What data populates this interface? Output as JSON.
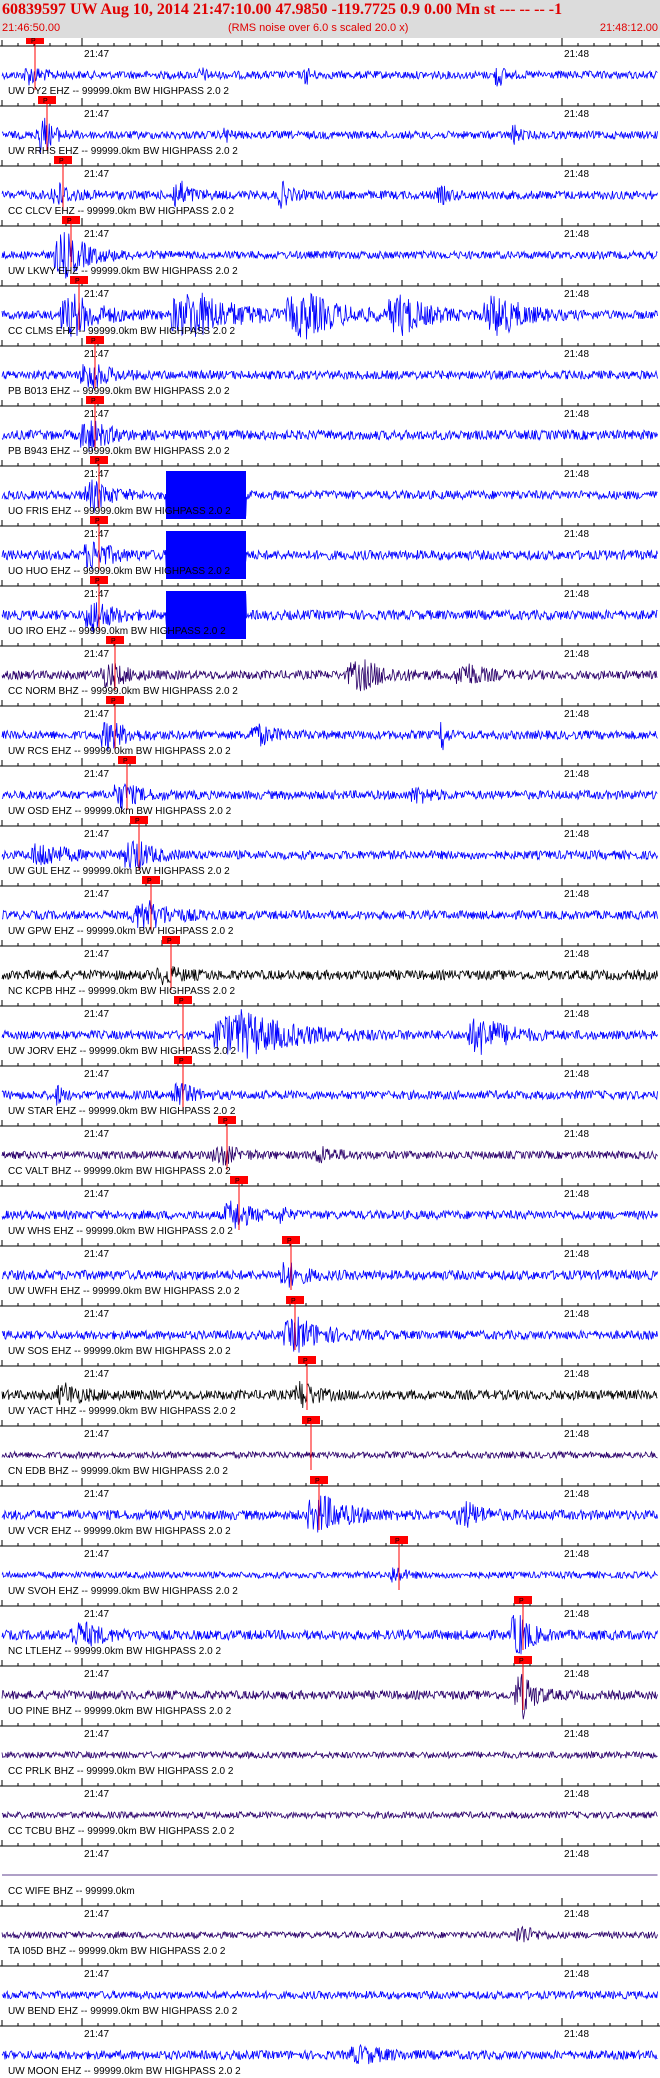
{
  "header": {
    "title": "60839597 UW Aug 10, 2014 21:47:10.00   47.9850 -119.7725  0.9 0.00 Mn st --- -- --  -1",
    "start_time": "21:46:50.00",
    "rms_note": "(RMS noise over 6.0 s scaled 20.0 x)",
    "end_time": "21:48:12.00"
  },
  "chart_data": {
    "type": "seismogram",
    "time_range": [
      "21:46:50.00",
      "21:48:12.00"
    ],
    "minute_labels": [
      {
        "label": "21:47",
        "t": 10
      },
      {
        "label": "21:48",
        "t": 70
      }
    ],
    "pick_label": "P",
    "colors": {
      "blue": "#0000ff",
      "purple": "#2a006a",
      "black": "#000000",
      "pick": "#ff0000",
      "axis": "#000000"
    },
    "traces": [
      {
        "label": "UW DY2 EHZ -- 99999.0km BW  HIGHPASS  2.0  2",
        "color": "blue",
        "pick": 3.0,
        "amp": 0.18,
        "bursts": [
          [
            3.5,
            0.35,
            1.5
          ],
          [
            25,
            0.25,
            0.6
          ],
          [
            38,
            0.4,
            0.5
          ],
          [
            62,
            0.6,
            0.6
          ]
        ]
      },
      {
        "label": "UW RRHS EHZ -- 99999.0km BW  HIGHPASS  2.0  2",
        "color": "blue",
        "pick": 4.5,
        "amp": 0.18,
        "bursts": [
          [
            5,
            0.9,
            1.2
          ],
          [
            28,
            0.3,
            0.5
          ],
          [
            64,
            0.4,
            0.6
          ]
        ]
      },
      {
        "label": "CC CLCV EHZ -- 99999.0km BW  HIGHPASS  2.0  2",
        "color": "blue",
        "pick": 6.5,
        "amp": 0.2,
        "bursts": [
          [
            7,
            0.5,
            1.5
          ],
          [
            22,
            0.7,
            1.2
          ],
          [
            35,
            0.5,
            1
          ],
          [
            55,
            0.3,
            1
          ]
        ]
      },
      {
        "label": "UW LKWY EHZ -- 99999.0km BW  HIGHPASS  2.0  2",
        "color": "blue",
        "pick": 7.5,
        "amp": 0.18,
        "bursts": [
          [
            8,
            1,
            2.5
          ]
        ]
      },
      {
        "label": "CC CLMS EHZ -- 99999.0km BW  HIGHPASS  2.0  2",
        "color": "blue",
        "pick": 8.5,
        "amp": 0.2,
        "bursts": [
          [
            9,
            0.9,
            3
          ],
          [
            24,
            1,
            5
          ],
          [
            38,
            0.9,
            4
          ],
          [
            50,
            0.8,
            3
          ],
          [
            62,
            0.9,
            3
          ]
        ]
      },
      {
        "label": "PB B013 EHZ -- 99999.0km BW  HIGHPASS  2.0  2",
        "color": "blue",
        "pick": 10.5,
        "amp": 0.2,
        "bursts": [
          [
            11,
            0.6,
            2
          ]
        ]
      },
      {
        "label": "PB B943 EHZ -- 99999.0km BW  HIGHPASS  2.0  2",
        "color": "blue",
        "pick": 10.5,
        "amp": 0.22,
        "bursts": [
          [
            11,
            0.7,
            2
          ]
        ]
      },
      {
        "label": "UO FRIS EHZ -- 99999.0km BW  HIGHPASS  2.0  2",
        "color": "blue",
        "pick": 11.0,
        "amp": 0.2,
        "bursts": [
          [
            11.5,
            0.6,
            2
          ]
        ],
        "block": [
          20.5,
          30.5
        ]
      },
      {
        "label": "UO HUO EHZ -- 99999.0km BW  HIGHPASS  2.0  2",
        "color": "blue",
        "pick": 11.0,
        "amp": 0.22,
        "bursts": [
          [
            11.5,
            0.6,
            2
          ]
        ],
        "block": [
          20.5,
          30.5
        ]
      },
      {
        "label": "UO IRO EHZ -- 99999.0km BW  HIGHPASS  2.0  2",
        "color": "blue",
        "pick": 11.0,
        "amp": 0.22,
        "bursts": [
          [
            11.5,
            0.7,
            2
          ]
        ],
        "block": [
          20.5,
          30.5
        ]
      },
      {
        "label": "CC NORM BHZ -- 99999.0km BW  HIGHPASS  2.0  2",
        "color": "purple",
        "pick": 13.0,
        "amp": 0.2,
        "bursts": [
          [
            13.5,
            0.5,
            2
          ],
          [
            45,
            0.6,
            3
          ],
          [
            58,
            0.5,
            2
          ]
        ]
      },
      {
        "label": "UW RCS EHZ -- 99999.0km BW  HIGHPASS  2.0  2",
        "color": "blue",
        "pick": 13.0,
        "amp": 0.2,
        "bursts": [
          [
            13.5,
            0.6,
            2
          ],
          [
            32,
            0.4,
            2
          ],
          [
            55,
            0.9,
            0.4
          ]
        ]
      },
      {
        "label": "UW OSD EHZ -- 99999.0km BW  HIGHPASS  2.0  2",
        "color": "blue",
        "pick": 14.5,
        "amp": 0.2,
        "bursts": [
          [
            15,
            0.5,
            2
          ],
          [
            52,
            0.3,
            1.5
          ]
        ]
      },
      {
        "label": "UW GUL EHZ -- 99999.0km BW  HIGHPASS  2.0  2",
        "color": "blue",
        "pick": 16.0,
        "amp": 0.2,
        "bursts": [
          [
            5,
            0.5,
            2.5
          ],
          [
            16.5,
            0.7,
            2
          ]
        ]
      },
      {
        "label": "UW GPW EHZ -- 99999.0km BW  HIGHPASS  2.0  2",
        "color": "blue",
        "pick": 17.5,
        "amp": 0.2,
        "bursts": [
          [
            18,
            0.6,
            3
          ]
        ]
      },
      {
        "label": "NC KCPB HHZ -- 99999.0km BW  HIGHPASS  2.0  2",
        "color": "black",
        "pick": 20.0,
        "amp": 0.22,
        "bursts": [
          [
            20.5,
            0.3,
            2
          ]
        ]
      },
      {
        "label": "UW JORV EHZ -- 99999.0km BW  HIGHPASS  2.0  2",
        "color": "blue",
        "pick": 21.5,
        "amp": 0.2,
        "bursts": [
          [
            30,
            1,
            6
          ],
          [
            60,
            0.8,
            3
          ]
        ]
      },
      {
        "label": "UW STAR EHZ -- 99999.0km BW  HIGHPASS  2.0  2",
        "color": "blue",
        "pick": 21.5,
        "amp": 0.2,
        "bursts": [
          [
            7,
            0.4,
            0.6
          ],
          [
            22,
            0.6,
            1.5
          ]
        ]
      },
      {
        "label": "CC VALT BHZ -- 99999.0km BW  HIGHPASS  2.0  2",
        "color": "purple",
        "pick": 27.0,
        "amp": 0.18,
        "bursts": [
          [
            27.5,
            0.4,
            2
          ],
          [
            40,
            0.3,
            2
          ]
        ]
      },
      {
        "label": "UW WHS EHZ -- 99999.0km BW  HIGHPASS  2.0  2",
        "color": "blue",
        "pick": 28.5,
        "amp": 0.2,
        "bursts": [
          [
            29,
            0.6,
            2
          ],
          [
            35,
            0.4,
            0.5
          ]
        ]
      },
      {
        "label": "UW UWFH EHZ -- 99999.0km BW  HIGHPASS  2.0  2",
        "color": "blue",
        "pick": 35.0,
        "amp": 0.22,
        "bursts": [
          [
            35.5,
            0.5,
            2
          ]
        ]
      },
      {
        "label": "UW SOS EHZ -- 99999.0km BW  HIGHPASS  2.0  2",
        "color": "blue",
        "pick": 35.5,
        "amp": 0.2,
        "bursts": [
          [
            37,
            0.7,
            3
          ]
        ]
      },
      {
        "label": "UW YACT HHZ -- 99999.0km BW  HIGHPASS  2.0  2",
        "color": "black",
        "pick": 37.0,
        "amp": 0.22,
        "bursts": [
          [
            8,
            0.4,
            2
          ],
          [
            37.5,
            0.6,
            1.5
          ]
        ]
      },
      {
        "label": "CN EDB BHZ -- 99999.0km BW  HIGHPASS  2.0  2",
        "color": "purple",
        "pick": 37.5,
        "amp": 0.15,
        "bursts": []
      },
      {
        "label": "UW VCR EHZ -- 99999.0km BW  HIGHPASS  2.0  2",
        "color": "blue",
        "pick": 38.5,
        "amp": 0.22,
        "bursts": [
          [
            40,
            0.8,
            3
          ],
          [
            58,
            0.5,
            2
          ]
        ]
      },
      {
        "label": "UW SVOH EHZ -- 99999.0km BW  HIGHPASS  2.0  2",
        "color": "blue",
        "pick": 48.5,
        "amp": 0.15,
        "bursts": [
          [
            49,
            0.4,
            1
          ]
        ]
      },
      {
        "label": "NC LTLEHZ -- 99999.0km BW  HIGHPASS  2.0  2",
        "color": "blue",
        "pick": 64.0,
        "amp": 0.22,
        "bursts": [
          [
            10,
            0.5,
            2.5
          ],
          [
            64.5,
            1,
            1.5
          ]
        ]
      },
      {
        "label": "UO PINE BHZ -- 99999.0km BW  HIGHPASS  2.0  2",
        "color": "purple",
        "pick": 64.0,
        "amp": 0.2,
        "bursts": [
          [
            65,
            1,
            1.5
          ]
        ]
      },
      {
        "label": "CC PRLK BHZ -- 99999.0km BW  HIGHPASS  2.0  2",
        "color": "purple",
        "amp": 0.15,
        "bursts": []
      },
      {
        "label": "CC TCBU BHZ -- 99999.0km BW  HIGHPASS  2.0  2",
        "color": "purple",
        "amp": 0.15,
        "bursts": []
      },
      {
        "label": "CC WIFE BHZ -- 99999.0km",
        "color": "purple",
        "amp": 0.0,
        "bursts": []
      },
      {
        "label": "TA I05D BHZ -- 99999.0km BW  HIGHPASS  2.0  2",
        "color": "purple",
        "amp": 0.15,
        "bursts": [
          [
            65,
            0.4,
            1.5
          ]
        ]
      },
      {
        "label": "UW BEND EHZ -- 99999.0km BW  HIGHPASS  2.0  2",
        "color": "blue",
        "amp": 0.18,
        "bursts": []
      },
      {
        "label": "UW MOON EHZ -- 99999.0km BW  HIGHPASS  2.0  2",
        "color": "blue",
        "amp": 0.2,
        "bursts": [
          [
            45,
            0.3,
            3
          ]
        ]
      }
    ]
  }
}
